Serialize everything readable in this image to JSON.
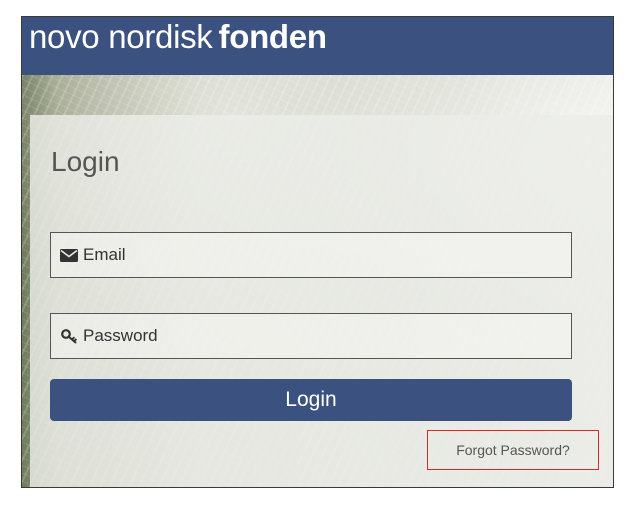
{
  "brand": {
    "light": "novo nordisk",
    "bold": "fonden"
  },
  "login": {
    "title": "Login",
    "email_placeholder": "Email",
    "password_placeholder": "Password",
    "button_label": "Login",
    "forgot_link": "Forgot Password?"
  },
  "icons": {
    "email": "envelope-icon",
    "password": "key-icon"
  },
  "colors": {
    "brand": "#3b5280",
    "highlight_border": "#d22a2a"
  }
}
